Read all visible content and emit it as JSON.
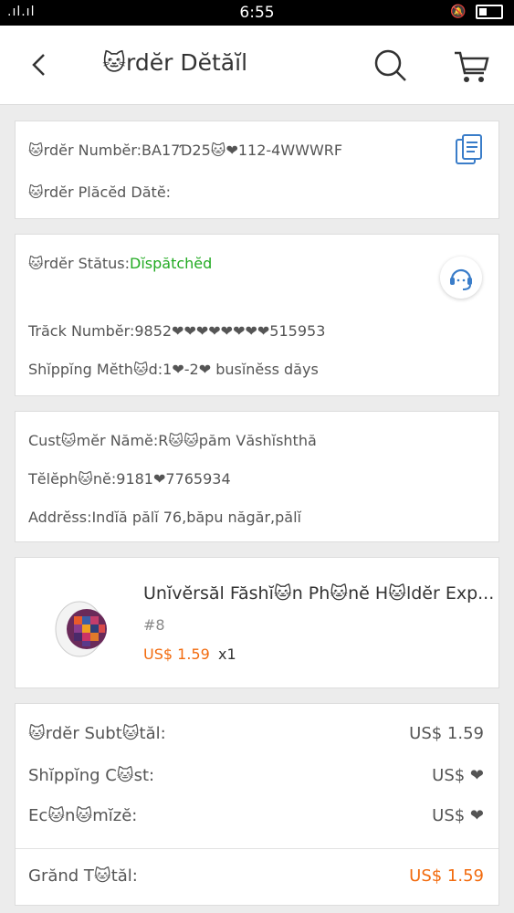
{
  "status_bar": {
    "signal": ".ıl.ıl",
    "time": "6:55"
  },
  "header": {
    "title": "🐱rdĕr Dĕtăĭl"
  },
  "order_info": {
    "order_number": "🐱rdĕr Numbĕr:BA17Ɗ25🐱❤112-4WWWRF",
    "order_date": "🐱rdĕr Plăcĕd Dătĕ:"
  },
  "shipping": {
    "status_label": "🐱rdĕr Stătus:",
    "status_value": "Dĭspătchĕd",
    "track_number": "Trăck Numbĕr:9852❤❤❤❤❤❤❤❤515953",
    "method": "Shĭppĭng Mĕth🐱d:1❤-2❤ busĭnĕss dăys"
  },
  "customer": {
    "name": "Cust🐱mĕr Nămĕ:R🐱🐱păm Văshĭshthă",
    "telephone": "Tĕlĕph🐱nĕ:9181❤7765934",
    "address": "Addrĕss:Indĭă pălĭ 76,băpu năgăr,pălĭ"
  },
  "product": {
    "title": "Unĭvĕrsăl Făshĭ🐱n Ph🐱nĕ H🐱ldĕr Exp...",
    "variant": "#8",
    "price": "US$ 1.59",
    "qty": "x1"
  },
  "summary": {
    "subtotal_label": "🐱rdĕr Subt🐱tăl:",
    "subtotal_value": "US$ 1.59",
    "shipping_label": "Shĭppĭng C🐱st:",
    "shipping_value": "US$ ❤",
    "economize_label": "Ec🐱n🐱mĭzĕ:",
    "economize_value": "US$ ❤",
    "grand_label": "Grănd T🐱tăl:",
    "grand_value": "US$ 1.59"
  },
  "colors": {
    "accent_orange": "#f26b0e",
    "status_green": "#22aa22",
    "icon_blue": "#3a7dc9"
  }
}
